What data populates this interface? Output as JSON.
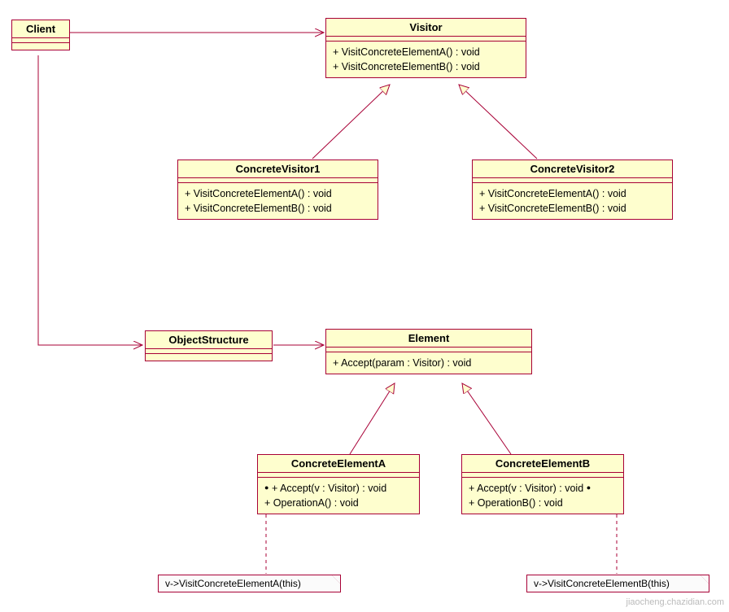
{
  "classes": {
    "client": {
      "name": "Client"
    },
    "visitor": {
      "name": "Visitor",
      "ops": [
        "+ VisitConcreteElementA() : void",
        "+ VisitConcreteElementB() : void"
      ]
    },
    "concreteVisitor1": {
      "name": "ConcreteVisitor1",
      "ops": [
        "+ VisitConcreteElementA() : void",
        "+ VisitConcreteElementB() : void"
      ]
    },
    "concreteVisitor2": {
      "name": "ConcreteVisitor2",
      "ops": [
        "+ VisitConcreteElementA() : void",
        "+ VisitConcreteElementB() : void"
      ]
    },
    "objectStructure": {
      "name": "ObjectStructure"
    },
    "element": {
      "name": "Element",
      "ops": [
        "+ Accept(param : Visitor) : void"
      ]
    },
    "concreteElementA": {
      "name": "ConcreteElementA",
      "ops": [
        "+ Accept(v : Visitor) : void",
        "+ OperationA() : void"
      ]
    },
    "concreteElementB": {
      "name": "ConcreteElementB",
      "ops": [
        "+ Accept(v : Visitor) : void",
        "+ OperationB() : void"
      ]
    }
  },
  "notes": {
    "a": "v->VisitConcreteElementA(this)",
    "b": "v->VisitConcreteElementB(this)"
  },
  "watermark": "jiaocheng.chazidian.com"
}
